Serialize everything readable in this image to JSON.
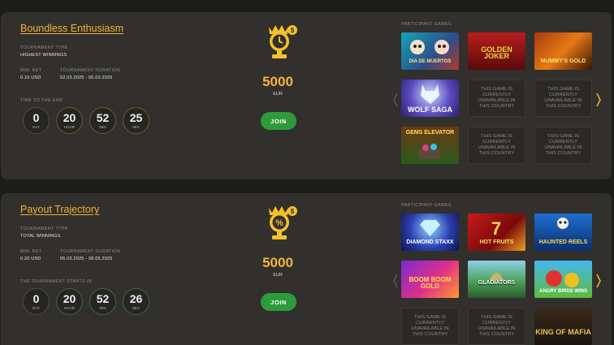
{
  "colors": {
    "accent": "#f2b233",
    "join": "#2e9b3b",
    "card": "#31302c"
  },
  "tournaments": [
    {
      "title": "Boundless Enthusiasm",
      "type_label": "Tournament type",
      "type_value": "Highest winnings",
      "minbet_label": "Min. bet",
      "minbet_value": "0.10 USD",
      "duration_label": "Tournament duration",
      "duration_value": "02.03.2025 - 05.03.2025",
      "timer_label": "Time to the end",
      "timer": [
        {
          "num": "0",
          "unit": "Day"
        },
        {
          "num": "20",
          "unit": "Hour"
        },
        {
          "num": "52",
          "unit": "Min"
        },
        {
          "num": "25",
          "unit": "Sec"
        }
      ],
      "trophy_icon": "trophy-clock-icon",
      "prize": "5000",
      "currency": "EUR",
      "join_label": "JOIN",
      "games_label": "Participant games",
      "games": [
        {
          "name": "DIA DE MUERTOS",
          "available": true
        },
        {
          "name": "GOLDEN JOKER",
          "available": true
        },
        {
          "name": "MUMMY'S GOLD",
          "available": true
        },
        {
          "name": "WOLF SAGA",
          "available": true
        },
        {
          "name": "This game is currently unavailable in this country",
          "available": false
        },
        {
          "name": "This game is currently unavailable in this country",
          "available": false
        },
        {
          "name": "GEMS ELEVATOR",
          "available": true
        },
        {
          "name": "This game is currently unavailable in this country",
          "available": false
        },
        {
          "name": "This game is currently unavailable in this country",
          "available": false
        }
      ]
    },
    {
      "title": "Payout Trajectory",
      "type_label": "Tournament type",
      "type_value": "Total winnings",
      "minbet_label": "Min. bet",
      "minbet_value": "0.20 USD",
      "duration_label": "Tournament duration",
      "duration_value": "05.03.2025 - 08.05.2025",
      "timer_label": "The tournament starts in",
      "timer": [
        {
          "num": "0",
          "unit": "Day"
        },
        {
          "num": "20",
          "unit": "Hour"
        },
        {
          "num": "52",
          "unit": "Min"
        },
        {
          "num": "26",
          "unit": "Sec"
        }
      ],
      "trophy_icon": "trophy-percent-icon",
      "prize": "5000",
      "currency": "EUR",
      "join_label": "JOIN",
      "games_label": "Participant games",
      "games": [
        {
          "name": "DIAMOND STAXX",
          "available": true
        },
        {
          "name": "HOT FRUITS",
          "available": true
        },
        {
          "name": "HAUNTED REELS",
          "available": true
        },
        {
          "name": "BOOM BOOM GOLD",
          "available": true
        },
        {
          "name": "GLADIATORS",
          "available": true
        },
        {
          "name": "ANGRY BIRDS WINS",
          "available": true
        },
        {
          "name": "This game is currently unavailable in this country",
          "available": false
        },
        {
          "name": "This game is currently unavailable in this country",
          "available": false
        },
        {
          "name": "KING OF MAFIA",
          "available": true
        }
      ]
    }
  ]
}
